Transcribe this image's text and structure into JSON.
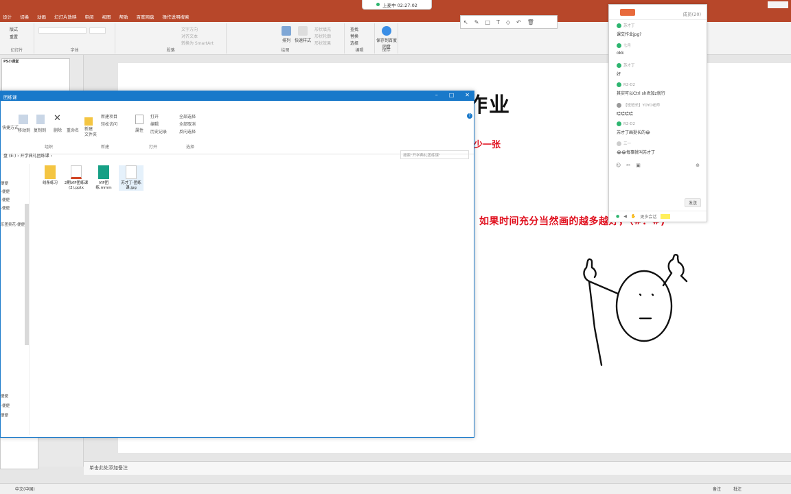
{
  "ppt": {
    "tabs": [
      "设计",
      "切换",
      "动画",
      "幻灯片放映",
      "审阅",
      "视图",
      "帮助",
      "百度网盘",
      "操作说明搜索"
    ],
    "ribbon_groups": [
      "幻灯片",
      "字体",
      "段落",
      "绘图",
      "编辑",
      "保存"
    ],
    "ribbon_items": {
      "layout": "版式",
      "reset": "重置",
      "find": "查找",
      "replace": "替换",
      "select": "选择",
      "arrange": "排列",
      "quick_styles": "快速样式",
      "save_to_cloud": "保存到百度网盘",
      "text_direction": "文字方向",
      "align_text": "对齐文本",
      "smartart": "转换为 SmartArt",
      "shape_fill": "形状填充",
      "shape_outline": "形状轮廓",
      "shape_effects": "形状效果"
    },
    "notes_placeholder": "单击此处添加备注",
    "status": {
      "language": "中文(中国)",
      "notes": "备注",
      "comments": "批注"
    },
    "thumb_title": "PS小课堂"
  },
  "share": {
    "label": "上麦中 02:27:02"
  },
  "slide": {
    "title": "作业",
    "subtitle": "少一张",
    "note": "如果时间充分当然画的越多越好，（#．#)"
  },
  "explorer": {
    "title": "团练课",
    "ribbon": {
      "groups": [
        "组织",
        "新建",
        "打开",
        "选择"
      ],
      "new_item": "新建项目",
      "easy_access": "轻松访问",
      "new_folder": "新建\n文件夹",
      "move_to": "移动到",
      "copy_to": "复制到",
      "delete": "删除",
      "rename": "重命名",
      "properties": "属性",
      "open": "打开",
      "edit": "编辑",
      "history": "历史记录",
      "select_all": "全部选择",
      "select_none": "全部取消",
      "invert": "反向选择",
      "paste": "粘贴快捷方式",
      "shortcut_left": "快捷方式"
    },
    "breadcrumb": "盘 (E:) › 开学典礼团练课 ›",
    "search_placeholder": "搜索\"开学典礼团练课\"",
    "nav": [
      "便便",
      "-便便",
      "-便便",
      "-便便",
      "乐团卖花-便便",
      "便便",
      "-便便",
      "便便"
    ],
    "files": [
      {
        "name": "线条练习",
        "icon": "folder-icon"
      },
      {
        "name": "2期VIP团练课(2).pptx",
        "icon": "pptx-icon"
      },
      {
        "name": "VIP团练.mmm",
        "icon": "mindmaster-icon"
      },
      {
        "name": "苏才丁-团练课.jpg",
        "icon": "image-icon"
      }
    ]
  },
  "chat": {
    "members": "成员(20)",
    "messages": [
      {
        "user": "苏才丁",
        "text": "课交作业jpg?"
      },
      {
        "user": "七月",
        "text": "okk"
      },
      {
        "user": "苏才丁",
        "text": "好"
      },
      {
        "user": "R2-D2",
        "text": "其实可以Ctrl shift加z就行"
      },
      {
        "user": "【班班长】YOYO老师",
        "text": "哈哈哈哈"
      },
      {
        "user": "R2-D2",
        "text": "苏才丁画挺长的😂"
      },
      {
        "user": "三一",
        "text": "😂😂每事就叫苏才丁"
      }
    ],
    "send": "发送",
    "footer": "更多会话"
  },
  "colors": {
    "ppt_red": "#b7472a",
    "explorer_blue": "#1979ca",
    "slide_red": "#e0101e",
    "chat_green": "#2db56f"
  }
}
